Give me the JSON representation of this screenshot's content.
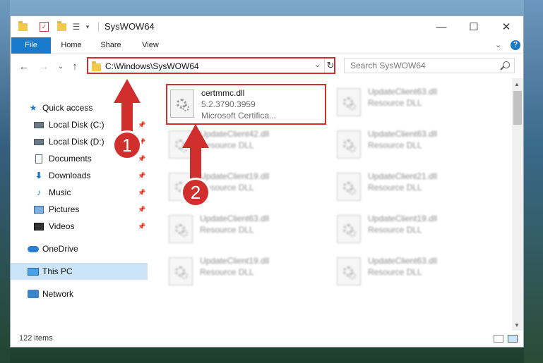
{
  "window": {
    "title": "SysWOW64",
    "controls": {
      "minimize": "—",
      "maximize": "☐",
      "close": "✕"
    },
    "qat_dropdown": "▾"
  },
  "ribbon": {
    "tabs": [
      "File",
      "Home",
      "Share",
      "View"
    ],
    "expand": "⌄",
    "help": "?"
  },
  "address_bar": {
    "path": "C:\\Windows\\SysWOW64",
    "dropdown": "⌄",
    "refresh": "↻"
  },
  "nav_buttons": {
    "back": "←",
    "forward": "→",
    "recent": "⌄",
    "up": "↑"
  },
  "search": {
    "placeholder": "Search SysWOW64"
  },
  "sidebar": {
    "items": [
      {
        "label": "Quick access",
        "icon": "star-icon",
        "pinned": false
      },
      {
        "label": "Local Disk (C:)",
        "icon": "disk-icon",
        "pinned": true
      },
      {
        "label": "Local Disk (D:)",
        "icon": "disk-icon",
        "pinned": true
      },
      {
        "label": "Documents",
        "icon": "document-icon",
        "pinned": true
      },
      {
        "label": "Downloads",
        "icon": "download-icon",
        "pinned": true
      },
      {
        "label": "Music",
        "icon": "music-icon",
        "pinned": true
      },
      {
        "label": "Pictures",
        "icon": "pictures-icon",
        "pinned": true
      },
      {
        "label": "Videos",
        "icon": "videos-icon",
        "pinned": true
      },
      {
        "label": "OneDrive",
        "icon": "cloud-icon",
        "pinned": false
      },
      {
        "label": "This PC",
        "icon": "computer-icon",
        "pinned": false,
        "selected": true
      },
      {
        "label": "Network",
        "icon": "network-icon",
        "pinned": false
      }
    ],
    "pin_glyph": "📌"
  },
  "files": [
    {
      "name": "certmmc.dll",
      "line1": "5.2.3790.3959",
      "line2": "Microsoft Certifica...",
      "selected": true
    },
    {
      "name": "UpdateClient63.dll",
      "line1": "Resource DLL"
    },
    {
      "name": "UpdateClient42.dll",
      "line1": "Resource DLL"
    },
    {
      "name": "UpdateClient63.dll",
      "line1": "Resource DLL"
    },
    {
      "name": "UpdateClient19.dll",
      "line1": "Resource DLL"
    },
    {
      "name": "UpdateClient21.dll",
      "line1": "Resource DLL"
    },
    {
      "name": "UpdateClient63.dll",
      "line1": "Resource DLL"
    },
    {
      "name": "UpdateClient19.dll",
      "line1": "Resource DLL"
    },
    {
      "name": "UpdateClient19.dll",
      "line1": "Resource DLL"
    },
    {
      "name": "UpdateClient63.dll",
      "line1": "Resource DLL"
    }
  ],
  "status_bar": {
    "item_count": "122 items"
  },
  "annotations": {
    "step1": "1",
    "step2": "2"
  },
  "colors": {
    "accent": "#1979ca",
    "highlight": "#d12e2e",
    "selection": "#cce4f7"
  }
}
